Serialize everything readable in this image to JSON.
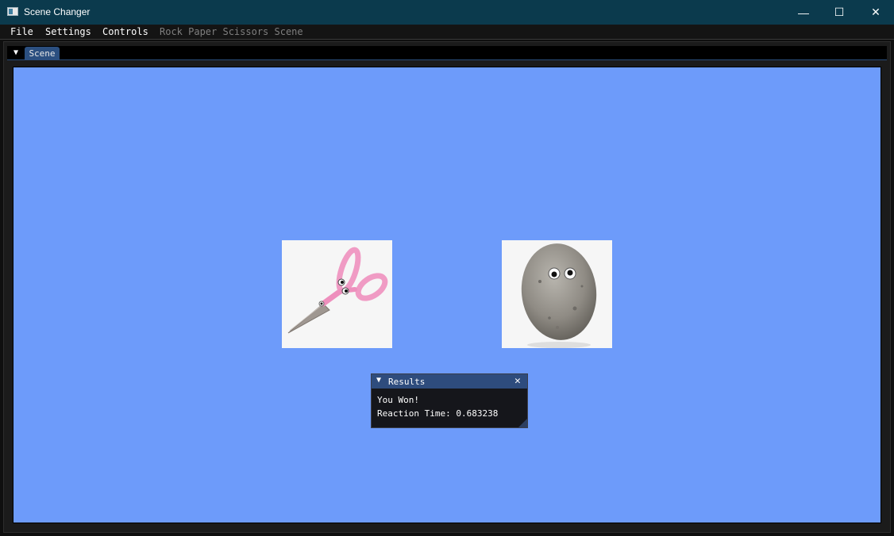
{
  "window": {
    "title": "Scene Changer",
    "controls": {
      "minimize": "—",
      "maximize": "☐",
      "close": "✕"
    }
  },
  "menu": {
    "items": [
      "File",
      "Settings",
      "Controls"
    ],
    "disabled_item": "Rock Paper Scissors Scene"
  },
  "dock": {
    "tab_arrow": "▼",
    "tab": "Scene"
  },
  "scene": {
    "background_color": "#6d9bfa",
    "player_choice": "scissors-image",
    "opponent_choice": "rock-image"
  },
  "results": {
    "arrow": "▼",
    "title": "Results",
    "close": "✕",
    "outcome": "You Won!",
    "reaction_time": "Reaction Time: 0.683238"
  }
}
